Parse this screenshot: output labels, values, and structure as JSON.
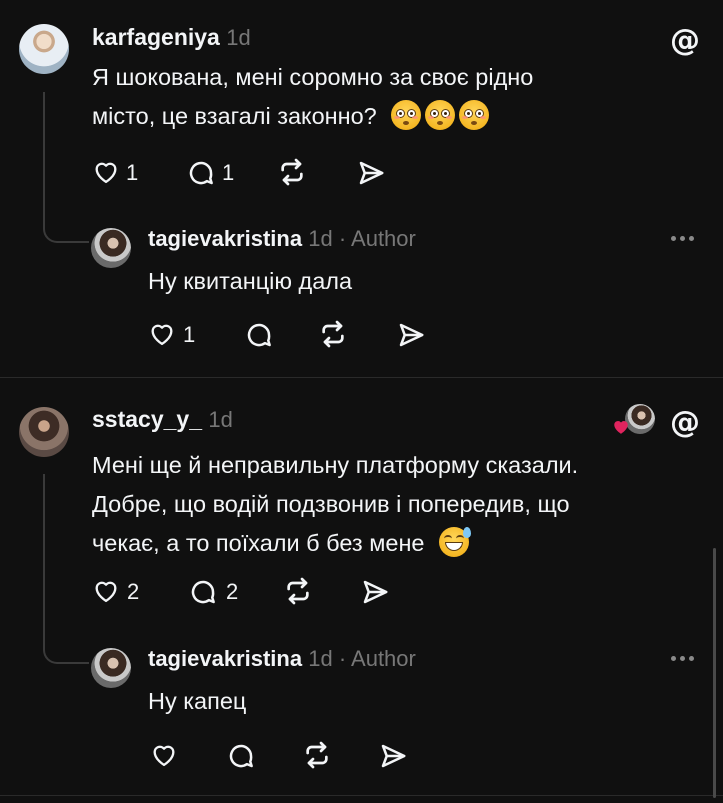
{
  "colors": {
    "background": "#101010",
    "text": "#f3f5f7",
    "muted": "#777777",
    "heart_accent": "#e0245e"
  },
  "threads": [
    {
      "comment": {
        "username": "karfageniya",
        "time": "1d",
        "lines": [
          "Я шокована, мені соромно за своє рідно",
          "місто, це взагалі законно?"
        ],
        "emojis": [
          "flushed-face",
          "flushed-face",
          "flushed-face"
        ],
        "likes": "1",
        "replies": "1"
      },
      "reply": {
        "username": "tagievakristina",
        "time": "1d",
        "author_label": "· Author",
        "text": "Ну квитанцію дала",
        "likes": "1"
      }
    },
    {
      "comment": {
        "username": "sstacy_y_",
        "time": "1d",
        "lines": [
          "Мені ще й неправильну платформу сказали.",
          "Добре, що водій подзвонив і попередив, що",
          "чекає, а то поїхали б без мене"
        ],
        "emojis": [
          "grinning-face-with-sweat"
        ],
        "likes": "2",
        "replies": "2"
      },
      "reply": {
        "username": "tagievakristina",
        "time": "1d",
        "author_label": "· Author",
        "text": "Ну капец",
        "likes": ""
      }
    }
  ]
}
